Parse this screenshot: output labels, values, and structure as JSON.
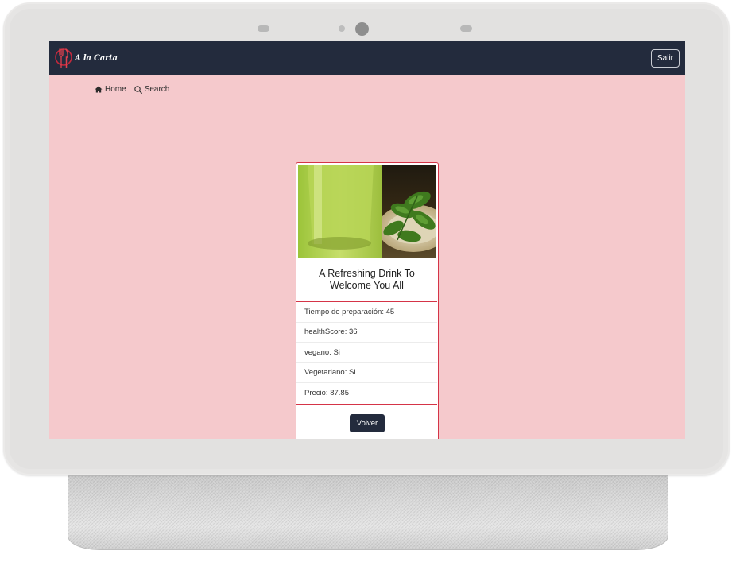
{
  "navbar": {
    "brand_text": "A la Carta",
    "logout_label": "Salir",
    "bg_color": "#232b3d",
    "logo_icon": "fork-knife-icon"
  },
  "subnav": {
    "home_label": "Home",
    "search_label": "Search"
  },
  "recipe": {
    "title": "A Refreshing Drink To Welcome You All",
    "details": [
      "Tiempo de preparación: 45",
      "healthScore: 36",
      "vegano: Si",
      "Vegetariano: Si",
      "Precio: 87.85"
    ],
    "back_label": "Volver"
  },
  "colors": {
    "page_bg": "#f5c9cc",
    "card_border": "#d53447",
    "button_bg": "#232b3d"
  }
}
